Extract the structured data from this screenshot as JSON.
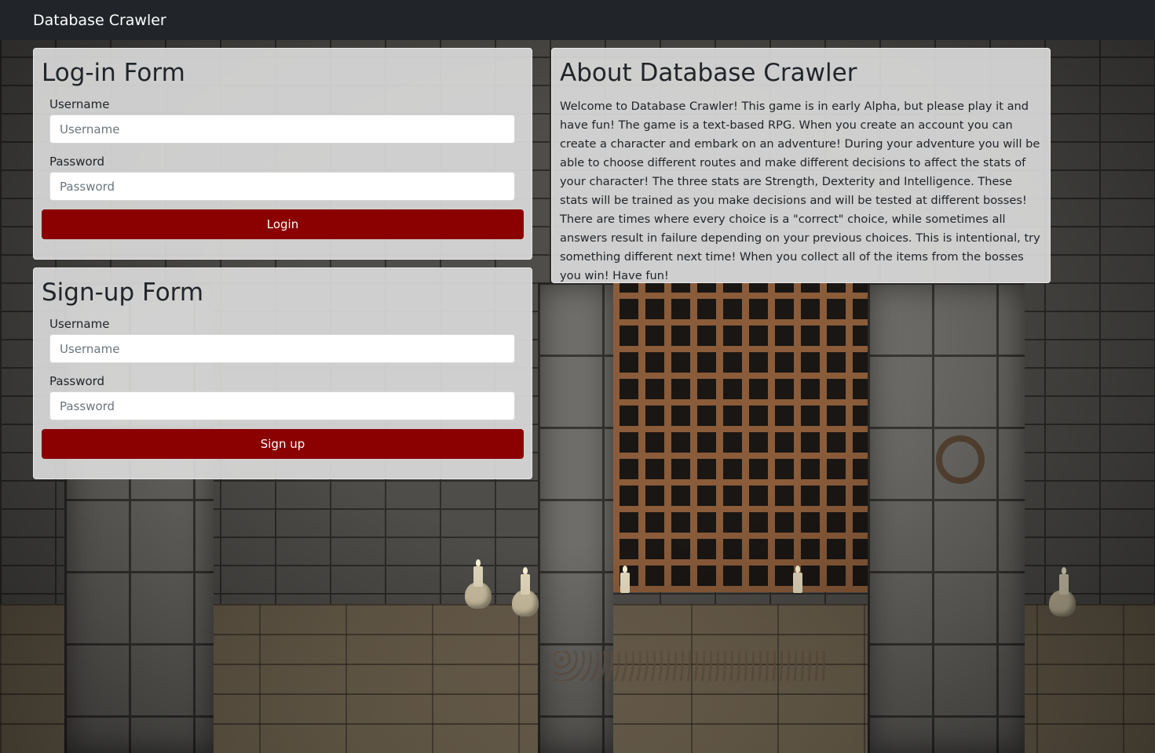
{
  "navbar": {
    "brand": "Database Crawler"
  },
  "login_form": {
    "title": "Log-in Form",
    "username_label": "Username",
    "username_placeholder": "Username",
    "username_value": "",
    "password_label": "Password",
    "password_placeholder": "Password",
    "password_value": "",
    "submit_label": "Login"
  },
  "signup_form": {
    "title": "Sign-up Form",
    "username_label": "Username",
    "username_placeholder": "Username",
    "username_value": "",
    "password_label": "Password",
    "password_placeholder": "Password",
    "password_value": "",
    "submit_label": "Sign up"
  },
  "about": {
    "title": "About Database Crawler",
    "body": "Welcome to Database Crawler! This game is in early Alpha, but please play it and have fun! The game is a text-based RPG. When you create an account you can create a character and embark on an adventure! During your adventure you will be able to choose different routes and make different decisions to affect the stats of your character! The three stats are Strength, Dexterity and Intelligence. These stats will be trained as you make decisions and will be tested at different bosses! There are times where every choice is a \"correct\" choice, while sometimes all answers result in failure depending on your previous choices. This is intentional, try something different next time! When you collect all of the items from the bosses you win! Have fun!"
  },
  "colors": {
    "navbar_bg": "#212529",
    "button_bg": "#8b0000",
    "card_bg": "rgba(222,222,222,0.9)"
  }
}
